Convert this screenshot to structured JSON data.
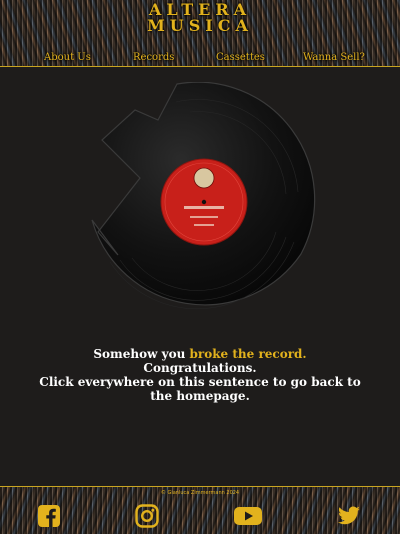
{
  "header": {
    "logo_line1": "ALTERA",
    "logo_line2": "MUSICA",
    "nav": [
      {
        "label": "About Us"
      },
      {
        "label": "Records"
      },
      {
        "label": "Cassettes"
      },
      {
        "label": "Wanna Sell?"
      }
    ]
  },
  "message": {
    "line1_prefix": "Somehow you ",
    "line1_highlight": "broke the record.",
    "line2": "Congratulations.",
    "line3": "Click everywhere on this sentence to go back to",
    "line4": "the homepage."
  },
  "footer": {
    "copyright": "© Gianluca Zimmermann 2024",
    "social": [
      {
        "icon": "facebook-icon"
      },
      {
        "icon": "instagram-icon"
      },
      {
        "icon": "youtube-icon"
      },
      {
        "icon": "twitter-icon"
      }
    ]
  },
  "colors": {
    "accent": "#e2b21d",
    "background": "#1e1c1b",
    "record_label": "#c8201a"
  }
}
